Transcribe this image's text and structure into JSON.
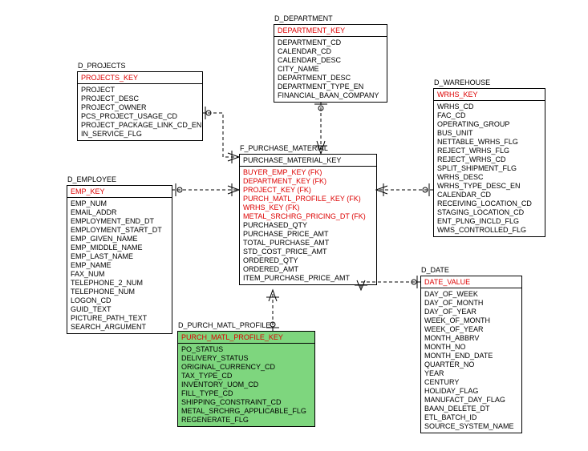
{
  "entities": {
    "projects": {
      "label": "D_PROJECTS",
      "key": "PROJECTS_KEY",
      "cols": [
        "PROJECT",
        "PROJECT_DESC",
        "PROJECT_OWNER",
        "PCS_PROJECT_USAGE_CD",
        "PROJECT_PACKAGE_LINK_CD_EN",
        "IN_SERVICE_FLG"
      ]
    },
    "department": {
      "label": "D_DEPARTMENT",
      "key": "DEPARTMENT_KEY",
      "cols": [
        "DEPARTMENT_CD",
        "CALENDAR_CD",
        "CALENDAR_DESC",
        "CITY_NAME",
        "DEPARTMENT_DESC",
        "DEPARTMENT_TYPE_EN",
        "FINANCIAL_BAAN_COMPANY"
      ]
    },
    "warehouse": {
      "label": "D_WAREHOUSE",
      "key": "WRHS_KEY",
      "cols": [
        "WRHS_CD",
        "FAC_CD",
        "OPERATING_GROUP",
        "BUS_UNIT",
        "NETTABLE_WRHS_FLG",
        "REJECT_WRHS_FLG",
        "REJECT_WRHS_CD",
        "SPLIT_SHIPMENT_FLG",
        "WRHS_DESC",
        "WRHS_TYPE_DESC_EN",
        "CALENDAR_CD",
        "RECEIVING_LOCATION_CD",
        "STAGING_LOCATION_CD",
        "ENT_PLNG_INCLD_FLG",
        "WMS_CONTROLLED_FLG"
      ]
    },
    "employee": {
      "label": "D_EMPLOYEE",
      "key": "EMP_KEY",
      "cols": [
        "EMP_NUM",
        "EMAIL_ADDR",
        "EMPLOYMENT_END_DT",
        "EMPLOYMENT_START_DT",
        "EMP_GIVEN_NAME",
        "EMP_MIDDLE_NAME",
        "EMP_LAST_NAME",
        "EMP_NAME",
        "FAX_NUM",
        "TELEPHONE_2_NUM",
        "TELEPHONE_NUM",
        "LOGON_CD",
        "GUID_TEXT",
        "PICTURE_PATH_TEXT",
        "SEARCH_ARGUMENT"
      ]
    },
    "fact": {
      "label": "F_PURCHASE_MATERIAL",
      "key": "PURCHASE_MATERIAL_KEY",
      "fks": [
        "BUYER_EMP_KEY (FK)",
        "DEPARTMENT_KEY (FK)",
        "PROJECT_KEY (FK)",
        "PURCH_MATL_PROFILE_KEY (FK)",
        "WRHS_KEY (FK)",
        "METAL_SRCHRG_PRICING_DT (FK)"
      ],
      "cols": [
        "PURCHASED_QTY",
        "PURCHASE_PRICE_AMT",
        "TOTAL_PURCHASE_AMT",
        "STD_COST_PRICE_AMT",
        "ORDERED_QTY",
        "ORDERED_AMT",
        "ITEM_PURCHASE_PRICE_AMT"
      ]
    },
    "profile": {
      "label": "D_PURCH_MATL_PROFILE",
      "key": "PURCH_MATL_PROFILE_KEY",
      "cols": [
        "PO_STATUS",
        "DELIVERY_STATUS",
        "ORIGINAL_CURRENCY_CD",
        "TAX_TYPE_CD",
        "INVENTORY_UOM_CD",
        "FILL_TYPE_CD",
        "SHIPPING_CONSTRAINT_CD",
        "METAL_SRCHRG_APPLICABLE_FLG",
        "REGENERATE_FLG"
      ]
    },
    "date": {
      "label": "D_DATE",
      "key": "DATE_VALUE",
      "cols": [
        "DAY_OF_WEEK",
        "DAY_OF_MONTH",
        "DAY_OF_YEAR",
        "WEEK_OF_MONTH",
        "WEEK_OF_YEAR",
        "MONTH_ABBRV",
        "MONTH_NO",
        "MONTH_END_DATE",
        "QUARTER_NO",
        "YEAR",
        "CENTURY",
        "HOLIDAY_FLAG",
        "MANUFACT_DAY_FLAG",
        "BAAN_DELETE_DT",
        "ETL_BATCH_ID",
        "SOURCE_SYSTEM_NAME"
      ]
    }
  }
}
